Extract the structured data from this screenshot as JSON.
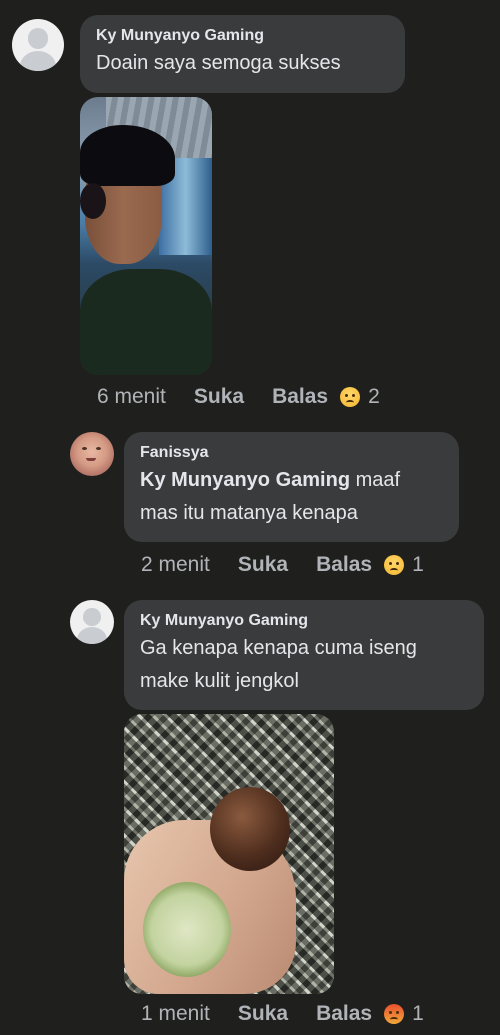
{
  "comments": [
    {
      "author": "Ky Munyanyo Gaming",
      "text": "Doain saya semoga sukses",
      "time": "6 menit",
      "like": "Suka",
      "reply": "Balas",
      "reaction": {
        "icon": "sad-reaction-icon",
        "count": "2"
      }
    },
    {
      "author": "Fanissya",
      "mention": "Ky Munyanyo Gaming",
      "text_line1": "maaf",
      "text_line2": "mas itu matanya kenapa",
      "time": "2 menit",
      "like": "Suka",
      "reply": "Balas",
      "reaction": {
        "icon": "sad-reaction-icon",
        "count": "1"
      }
    },
    {
      "author": "Ky Munyanyo Gaming",
      "text_line1": "Ga kenapa kenapa cuma iseng",
      "text_line2": "make kulit jengkol",
      "time": "1 menit",
      "like": "Suka",
      "reply": "Balas",
      "reaction": {
        "icon": "angry-reaction-icon",
        "count": "1"
      }
    }
  ],
  "colors": {
    "background": "#1f201d",
    "bubble": "#3a3b3c",
    "text": "#e4e6eb",
    "meta": "#b0b3b8"
  }
}
